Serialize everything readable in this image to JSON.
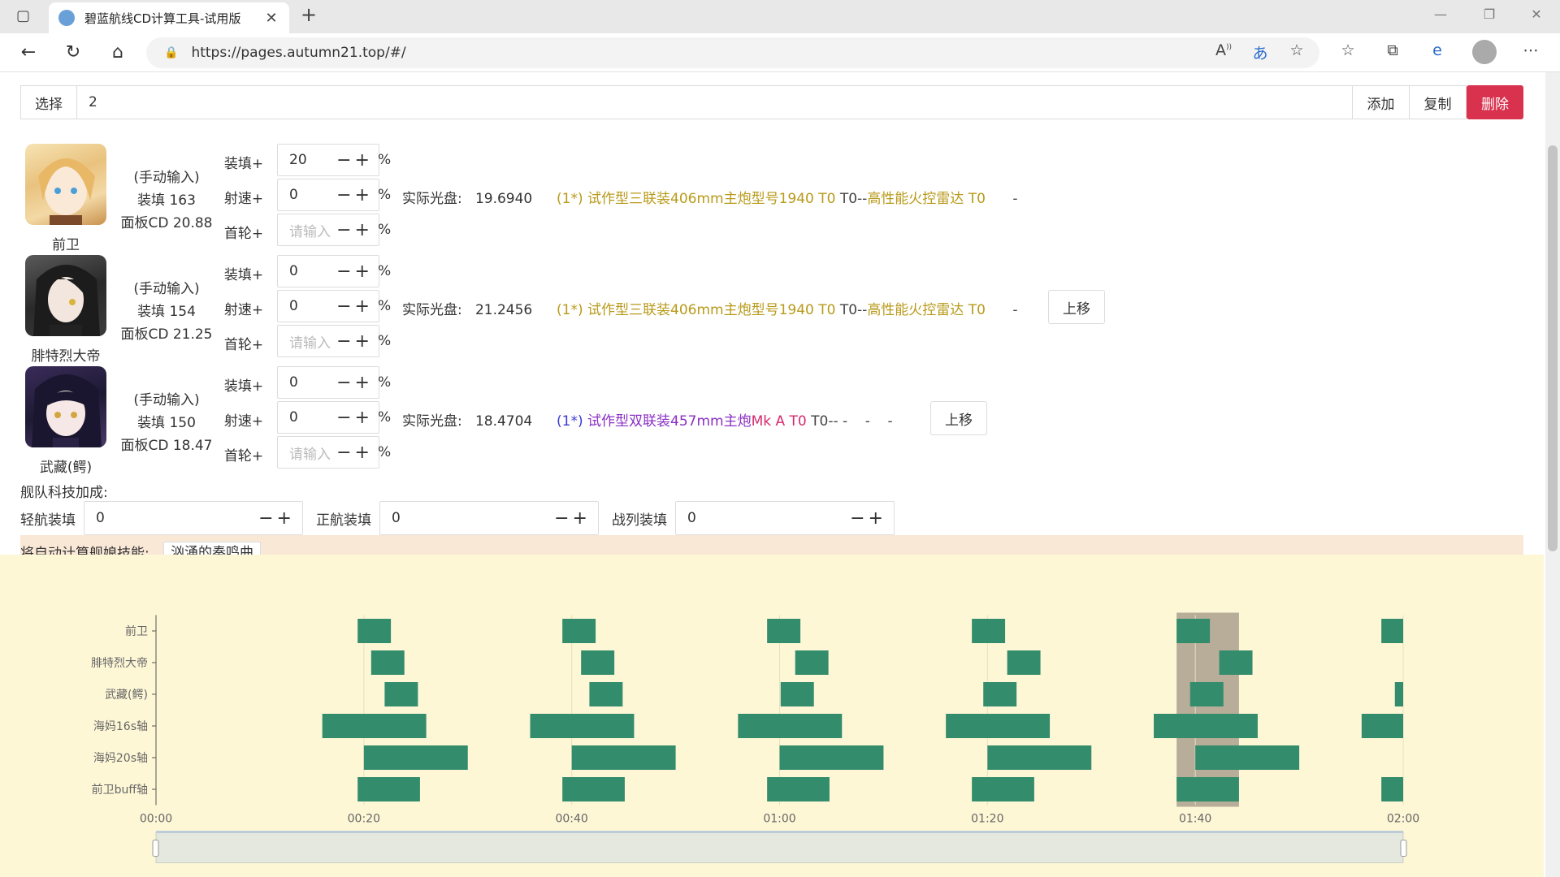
{
  "browser": {
    "tab_title": "碧蓝航线CD计算工具-试用版",
    "url": "https://pages.autumn21.top/#/"
  },
  "toolbar": {
    "select_label": "选择",
    "input_value": "2",
    "add_label": "添加",
    "copy_label": "复制",
    "delete_label": "删除"
  },
  "ships": [
    {
      "name": "前卫",
      "manual": "(手动输入)",
      "reload": "装填 163",
      "panel_cd": "面板CD 20.88",
      "reload_label": "装填+",
      "reload_value": "20",
      "firerate_label": "射速+",
      "firerate_value": "0",
      "first_label": "首轮+",
      "first_placeholder": "请输入",
      "pct": "%",
      "real_label": "实际光盘:",
      "real_value": "19.6940",
      "slot_prefix": "(1*)",
      "slot1": "试作型三联装406mm主炮型号1940 T0",
      "sep": "T0--",
      "slot2": "高性能火控雷达 T0",
      "dash": "-"
    },
    {
      "name": "腓特烈大帝",
      "manual": "(手动输入)",
      "reload": "装填 154",
      "panel_cd": "面板CD 21.25",
      "reload_label": "装填+",
      "reload_value": "0",
      "firerate_label": "射速+",
      "firerate_value": "0",
      "first_label": "首轮+",
      "first_placeholder": "请输入",
      "pct": "%",
      "real_label": "实际光盘:",
      "real_value": "21.2456",
      "slot_prefix": "(1*)",
      "slot1": "试作型三联装406mm主炮型号1940 T0",
      "sep": "T0--",
      "slot2": "高性能火控雷达 T0",
      "dash": "-",
      "move_label": "上移"
    },
    {
      "name": "武藏(鳄)",
      "manual": "(手动输入)",
      "reload": "装填 150",
      "panel_cd": "面板CD 18.47",
      "reload_label": "装填+",
      "reload_value": "0",
      "firerate_label": "射速+",
      "firerate_value": "0",
      "first_label": "首轮+",
      "first_placeholder": "请输入",
      "pct": "%",
      "real_label": "实际光盘:",
      "real_value": "18.4704",
      "slot_prefix": "(1*)",
      "slot1a": "试作型双联装457mm主炮",
      "slot1b": "Mk A T0",
      "sep": "T0--",
      "dashes": "-    -    -",
      "move_label": "上移"
    }
  ],
  "fleet": {
    "title": "舰队科技加成:",
    "light_label": "轻航装填",
    "light_value": "0",
    "fleet_label": "正航装填",
    "fleet_value": "0",
    "bb_label": "战列装填",
    "bb_value": "0"
  },
  "auto_skill": {
    "label": "将自动计算舰娘技能:",
    "button": "汹涌的奏鸣曲"
  },
  "colors": {
    "bar": "#338c6c",
    "highlight": "#b7ad98",
    "chart_bg": "#fdf7d6"
  },
  "chart_data": {
    "type": "bar",
    "subtype": "timeline",
    "categories": [
      "前卫",
      "腓特烈大帝",
      "武藏(鳄)",
      "海妈16s轴",
      "海妈20s轴",
      "前卫buff轴"
    ],
    "x_ticks": [
      "00:00",
      "00:20",
      "00:40",
      "01:00",
      "01:20",
      "01:40",
      "02:00"
    ],
    "xlim": [
      0,
      120
    ],
    "series": [
      {
        "values": [
          [
            19.4,
            22.6
          ],
          [
            39.1,
            42.3
          ],
          [
            58.8,
            62.0
          ],
          [
            78.5,
            81.7
          ],
          [
            98.2,
            101.4
          ],
          [
            117.9,
            120.0
          ]
        ]
      },
      {
        "values": [
          [
            20.7,
            23.9
          ],
          [
            40.9,
            44.1
          ],
          [
            61.5,
            64.7
          ],
          [
            81.9,
            85.1
          ],
          [
            102.3,
            105.5
          ]
        ]
      },
      {
        "values": [
          [
            22.0,
            25.2
          ],
          [
            41.7,
            44.9
          ],
          [
            60.1,
            63.3
          ],
          [
            79.6,
            82.8
          ],
          [
            99.5,
            102.7
          ],
          [
            119.2,
            120.0
          ]
        ]
      },
      {
        "values": [
          [
            16.0,
            26.0
          ],
          [
            36.0,
            46.0
          ],
          [
            56.0,
            66.0
          ],
          [
            76.0,
            86.0
          ],
          [
            96.0,
            106.0
          ],
          [
            116.0,
            120.0
          ]
        ]
      },
      {
        "values": [
          [
            20.0,
            30.0
          ],
          [
            40.0,
            50.0
          ],
          [
            60.0,
            70.0
          ],
          [
            80.0,
            90.0
          ],
          [
            100.0,
            110.0
          ]
        ]
      },
      {
        "values": [
          [
            19.4,
            25.4
          ],
          [
            39.1,
            45.1
          ],
          [
            58.8,
            64.8
          ],
          [
            78.5,
            84.5
          ],
          [
            98.2,
            104.2
          ],
          [
            117.9,
            120.0
          ]
        ]
      }
    ],
    "highlight_range": [
      98.2,
      104.2
    ],
    "grid": false
  }
}
